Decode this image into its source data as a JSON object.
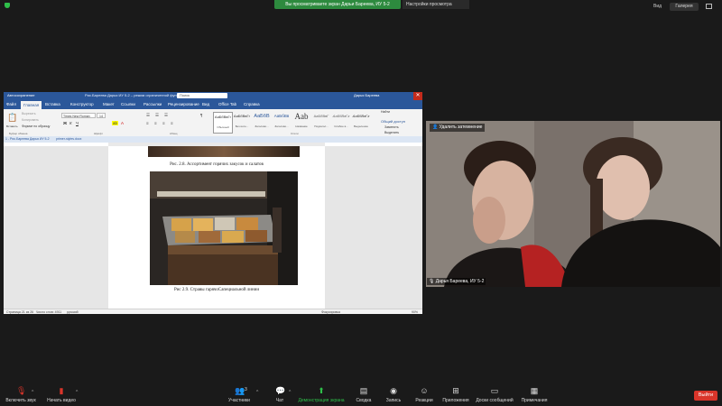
{
  "top_bar": {
    "share_banner": "Вы просматриваете экран Дарьи Бареева, ИУ 5-2",
    "view_options": "Настройки просмотра",
    "view_label": "Вид",
    "view_button": "Галерея"
  },
  "word": {
    "autosave": "Автосохранение",
    "doc_title": "Рис.Бареева Дарья ИУ 5-2 – режим ограниченной функц... • Word",
    "search_placeholder": "Поиск",
    "user": "Дарья Бареева",
    "tabs": [
      "Файл",
      "Главная",
      "Вставка",
      "Конструктор",
      "Макет",
      "Ссылки",
      "Рассылки",
      "Рецензирование",
      "Вид",
      "Office Tab",
      "Справка"
    ],
    "ribbon": {
      "paste": "Вставить",
      "cut": "Вырезать",
      "copy": "Копировать",
      "format_painter": "Формат по образцу",
      "font_name": "Times New Roman",
      "font_size": "14",
      "styles": [
        {
          "sample": "АаБбВвГг",
          "name": "Обычный"
        },
        {
          "sample": "АаБбВвГг",
          "name": "Без инте..."
        },
        {
          "sample": "АаБбВ",
          "name": "Заголово..."
        },
        {
          "sample": "АаБбВв",
          "name": "Заголово..."
        },
        {
          "sample": "Aab",
          "name": "Название"
        },
        {
          "sample": "АаБбВвГ",
          "name": "Подзагол..."
        },
        {
          "sample": "АаБбВвГг",
          "name": "Слабое в..."
        },
        {
          "sample": "АаБбВвГг",
          "name": "Выделение"
        }
      ],
      "share": "Общий доступ",
      "find": "Найти",
      "replace": "Заменить",
      "select": "Выделить",
      "groups": [
        "Буфер обмена",
        "Шрифт",
        "Абзац",
        "Стили",
        "Редактирование"
      ]
    },
    "doc_tabs": [
      "1 - Рис.Бареева Дарья ИУ 5-2",
      "primer-styles.docx"
    ],
    "caption1": "Рис. 2.8. Ассортимент горячих закусок и салатов",
    "caption2": "Рис 2.9. Стравы гарячоСапециальной линии",
    "status": {
      "page": "Страница 21 из 26",
      "words": "Число слов: 4911",
      "lang": "русский",
      "focus": "Фокусировка",
      "zoom": "90%"
    }
  },
  "video": {
    "label": "Удалить затемнение",
    "name": "Дарья Бареева, ИУ 5-2"
  },
  "toolbar": {
    "mute": "Включить звук",
    "video": "Начать видео",
    "participants": "Участники",
    "participants_count": "3",
    "chat": "Чат",
    "share": "Демонстрация экрана",
    "reactions": "Реакции",
    "record": "Запись",
    "apps": "Приложения",
    "whiteboards": "Доски сообщений",
    "notes": "Примечания",
    "summary": "Сводка",
    "leave": "Выйти"
  },
  "colors": {
    "word_blue": "#2b579a",
    "zoom_green": "#2fbf4a",
    "leave_red": "#d9352a"
  }
}
